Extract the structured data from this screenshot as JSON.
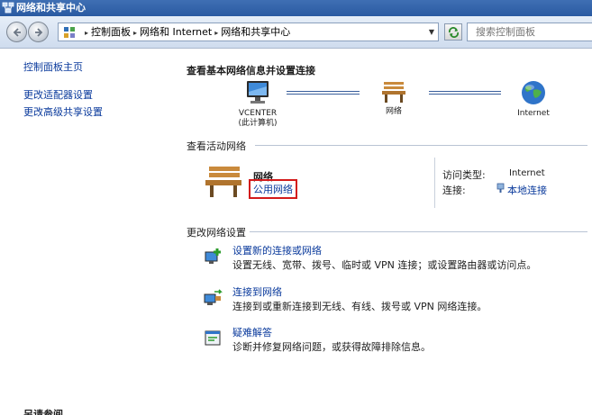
{
  "window": {
    "title": "网络和共享中心"
  },
  "address": {
    "crumbs": [
      "控制面板",
      "网络和 Internet",
      "网络和共享中心"
    ],
    "search_placeholder": "搜索控制面板"
  },
  "leftnav": {
    "home": "控制面板主页",
    "adapter": "更改适配器设置",
    "sharing": "更改高级共享设置",
    "see_also": "另请参阅"
  },
  "main": {
    "heading": "查看基本网络信息并设置连接",
    "map": {
      "computer_name": "VCENTER",
      "computer_sub": "(此计算机)",
      "network": "网络",
      "internet": "Internet"
    },
    "active": {
      "title": "查看活动网络",
      "network_name": "网络",
      "network_type": "公用网络",
      "access_label": "访问类型:",
      "access_value": "Internet",
      "conn_label": "连接:",
      "conn_value": "本地连接"
    },
    "change": {
      "title": "更改网络设置",
      "tasks": [
        {
          "link": "设置新的连接或网络",
          "desc": "设置无线、宽带、拨号、临时或 VPN 连接；或设置路由器或访问点。"
        },
        {
          "link": "连接到网络",
          "desc": "连接到或重新连接到无线、有线、拨号或 VPN 网络连接。"
        },
        {
          "link": "疑难解答",
          "desc": "诊断并修复网络问题，或获得故障排除信息。"
        }
      ]
    }
  },
  "colors": {
    "link": "#0a3a9c",
    "highlight_box": "#d31a1a",
    "titlebar": "#2a5aa2"
  }
}
